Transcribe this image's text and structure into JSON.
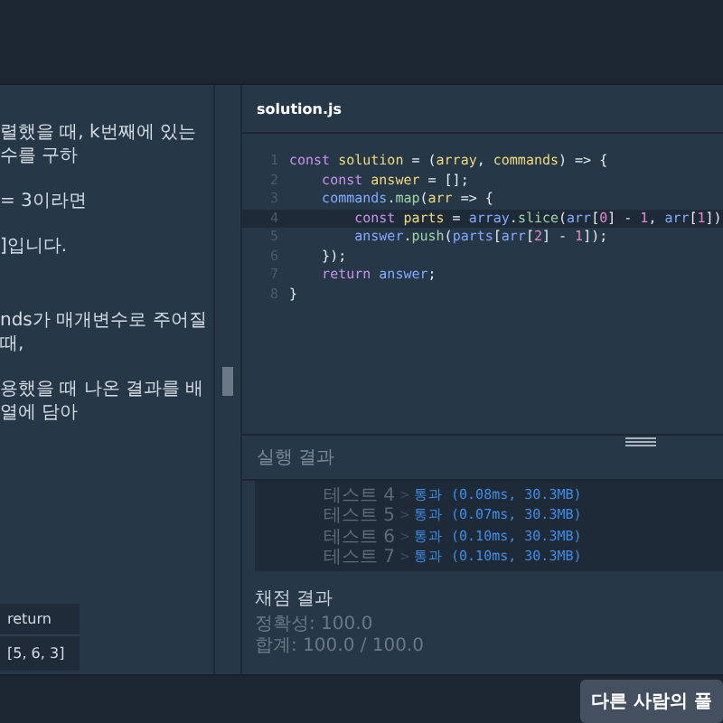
{
  "problem": {
    "paragraphs": [
      "렬했을 때, k번째에 있는 수를 구하",
      "= 3이라면",
      "]입니다.",
      "nds가 매개변수로 주어질 때,",
      "용했을 때 나온 결과를 배열에 담아"
    ],
    "example_table": {
      "header": "return",
      "cell": "[5, 6, 3]"
    }
  },
  "editor": {
    "filename": "solution.js",
    "lines": [
      {
        "number": "1",
        "highlighted": false,
        "tokens": [
          {
            "kind": "kw",
            "text": "const "
          },
          {
            "kind": "def",
            "text": "solution"
          },
          {
            "kind": "plain",
            "text": " = ("
          },
          {
            "kind": "def",
            "text": "array"
          },
          {
            "kind": "plain",
            "text": ", "
          },
          {
            "kind": "def",
            "text": "commands"
          },
          {
            "kind": "plain",
            "text": ") => {"
          }
        ]
      },
      {
        "number": "2",
        "highlighted": false,
        "tokens": [
          {
            "kind": "kw",
            "text": "    const "
          },
          {
            "kind": "def",
            "text": "answer"
          },
          {
            "kind": "plain",
            "text": " = [];"
          }
        ]
      },
      {
        "number": "3",
        "highlighted": false,
        "tokens": [
          {
            "kind": "var",
            "text": "    commands"
          },
          {
            "kind": "plain",
            "text": "."
          },
          {
            "kind": "fn",
            "text": "map"
          },
          {
            "kind": "plain",
            "text": "("
          },
          {
            "kind": "def",
            "text": "arr"
          },
          {
            "kind": "plain",
            "text": " => {"
          }
        ]
      },
      {
        "number": "4",
        "highlighted": true,
        "tokens": [
          {
            "kind": "kw",
            "text": "        const "
          },
          {
            "kind": "def",
            "text": "parts"
          },
          {
            "kind": "plain",
            "text": " = "
          },
          {
            "kind": "var",
            "text": "array"
          },
          {
            "kind": "plain",
            "text": "."
          },
          {
            "kind": "fn",
            "text": "slice"
          },
          {
            "kind": "plain",
            "text": "("
          },
          {
            "kind": "var",
            "text": "arr"
          },
          {
            "kind": "plain",
            "text": "["
          },
          {
            "kind": "num",
            "text": "0"
          },
          {
            "kind": "plain",
            "text": "] - "
          },
          {
            "kind": "num",
            "text": "1"
          },
          {
            "kind": "plain",
            "text": ", "
          },
          {
            "kind": "var",
            "text": "arr"
          },
          {
            "kind": "plain",
            "text": "["
          },
          {
            "kind": "num",
            "text": "1"
          },
          {
            "kind": "plain",
            "text": "])"
          }
        ]
      },
      {
        "number": "5",
        "highlighted": false,
        "tokens": [
          {
            "kind": "var",
            "text": "        answer"
          },
          {
            "kind": "plain",
            "text": "."
          },
          {
            "kind": "fn",
            "text": "push"
          },
          {
            "kind": "plain",
            "text": "("
          },
          {
            "kind": "var",
            "text": "parts"
          },
          {
            "kind": "plain",
            "text": "["
          },
          {
            "kind": "var",
            "text": "arr"
          },
          {
            "kind": "plain",
            "text": "["
          },
          {
            "kind": "num",
            "text": "2"
          },
          {
            "kind": "plain",
            "text": "] - "
          },
          {
            "kind": "num",
            "text": "1"
          },
          {
            "kind": "plain",
            "text": "]);"
          }
        ]
      },
      {
        "number": "6",
        "highlighted": false,
        "tokens": [
          {
            "kind": "plain",
            "text": "    });"
          }
        ]
      },
      {
        "number": "7",
        "highlighted": false,
        "tokens": [
          {
            "kind": "kw",
            "text": "    return "
          },
          {
            "kind": "var",
            "text": "answer"
          },
          {
            "kind": "plain",
            "text": ";"
          }
        ]
      },
      {
        "number": "8",
        "highlighted": false,
        "tokens": [
          {
            "kind": "plain",
            "text": "}"
          }
        ]
      }
    ]
  },
  "results": {
    "title": "실행 결과",
    "tests": [
      {
        "name": "테스트 4",
        "separator": ">",
        "result": "통과 (0.08ms, 30.3MB)"
      },
      {
        "name": "테스트 5",
        "separator": ">",
        "result": "통과 (0.07ms, 30.3MB)"
      },
      {
        "name": "테스트 6",
        "separator": ">",
        "result": "통과 (0.10ms, 30.3MB)"
      },
      {
        "name": "테스트 7",
        "separator": ">",
        "result": "통과 (0.10ms, 30.3MB)"
      }
    ],
    "grading_title": "채점 결과",
    "accuracy": "정확성: 100.0",
    "total": "합계: 100.0 / 100.0"
  },
  "footer": {
    "button": "다른 사람의 풀"
  }
}
